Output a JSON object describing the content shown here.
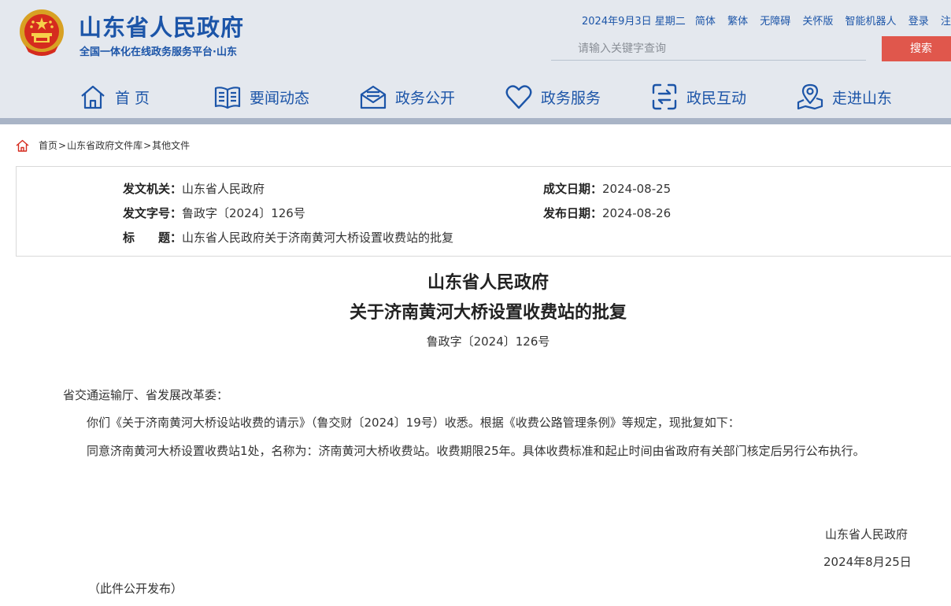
{
  "site": {
    "title": "山东省人民政府",
    "subtitle": "全国一体化在线政务服务平台·山东"
  },
  "toplinks": {
    "date": "2024年9月3日 星期二",
    "items": [
      "简体",
      "繁体",
      "无障碍",
      "关怀版",
      "智能机器人",
      "登录",
      "注册"
    ]
  },
  "search": {
    "placeholder": "请输入关键字查询",
    "button": "搜索"
  },
  "nav": [
    {
      "label": "首 页",
      "icon": "home-icon"
    },
    {
      "label": "要闻动态",
      "icon": "book-icon"
    },
    {
      "label": "政务公开",
      "icon": "mail-icon"
    },
    {
      "label": "政务服务",
      "icon": "heart-icon"
    },
    {
      "label": "政民互动",
      "icon": "interaction-icon"
    },
    {
      "label": "走进山东",
      "icon": "location-icon"
    }
  ],
  "breadcrumb": [
    "首页",
    "山东省政府文件库",
    "其他文件"
  ],
  "info": {
    "issuer_key": "发文机关：",
    "issuer": "山东省人民政府",
    "docno_key": "发文字号：",
    "docno": "鲁政字〔2024〕126号",
    "title_key": "标　　题：",
    "title": "山东省人民政府关于济南黄河大桥设置收费站的批复",
    "made_key": "成文日期：",
    "made": "2024-08-25",
    "pub_key": "发布日期：",
    "pub": "2024-08-26"
  },
  "doc": {
    "title_line1": "山东省人民政府",
    "title_line2": "关于济南黄河大桥设置收费站的批复",
    "number": "鲁政字〔2024〕126号",
    "salutation": "省交通运输厅、省发展改革委：",
    "para1": "你们《关于济南黄河大桥设站收费的请示》（鲁交财〔2024〕19号）收悉。根据《收费公路管理条例》等规定，现批复如下：",
    "para2": "同意济南黄河大桥设置收费站1处，名称为：济南黄河大桥收费站。收费期限25年。具体收费标准和起止时间由省政府有关部门核定后另行公布执行。",
    "sign_org": "山东省人民政府",
    "sign_date": "2024年8月25日",
    "public_note": "（此件公开发布）"
  },
  "colors": {
    "brand_blue": "#1c55a8",
    "search_red": "#e0574c",
    "header_bg": "#e4e8ee"
  }
}
